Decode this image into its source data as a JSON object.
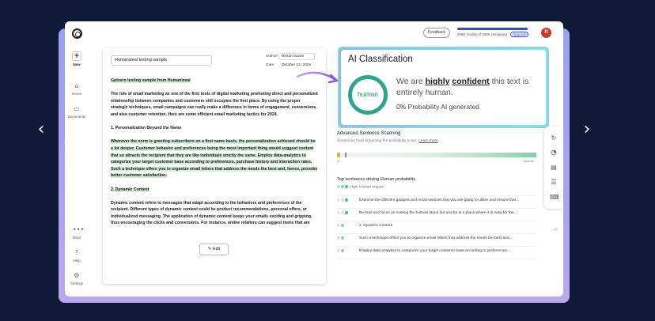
{
  "nav": {
    "prev": "‹",
    "next": "›"
  },
  "topbar": {
    "feedback_label": "Feedback",
    "credits_text": "298K credits of 300K remaining",
    "credits_fraction": 0.99,
    "upgrade_label": "Upgrade",
    "avatar_initial": "R"
  },
  "sidebar": {
    "new_label": "New",
    "items": [
      {
        "label": "Home",
        "icon": "home-icon",
        "glyph": "⌂"
      },
      {
        "label": "Documents",
        "icon": "folder-icon",
        "glyph": "▭"
      },
      {
        "label": "More",
        "icon": "more-icon",
        "glyph": "•••"
      },
      {
        "label": "Help",
        "icon": "help-icon",
        "glyph": "?"
      },
      {
        "label": "Settings",
        "icon": "gear-icon",
        "glyph": "⚙"
      }
    ]
  },
  "document": {
    "title": "Humanizeai testing sample",
    "author_label": "Author:",
    "author": "Rezan buzan",
    "date_label": "Date:",
    "date": "October 12, 2024",
    "heading": "Gptzero testing sample from Humanizeai",
    "p1": "The role of email marketing as one of the first tools of digital marketing promoting direct and personalized relationship between companies and customers still occupies the first place. By using the proper strategic techniques, email campaigns can really make a difference in terms of engagement, conversions, and also customer retention. Here are some efficient email marketing tactics for 2024.",
    "h1": "1. Personalization Beyond the Name",
    "p2": "Wherever the norm is greeting subscribers on a first name basis, the personalization achieved should be a lot deeper. Customer behavior and preferences being the most important thing would suggest content that so attracts the recipient that they are like individuals strictly the same. Employ data-analytics to categorize your target customer base according to preferences, purchase history and interaction rates. Such a technique offers you to organize email letters that address the needs the best and, hence, provoke better customer satisfaction.",
    "h2": "2. Dynamic Content",
    "p3": "Dynamic content refers to messages that adapt according to the behaviors and preferences of the recipient. Different types of dynamic content could be product recommendations, personal offers, or individualized messaging. The application of dynamic content keeps your emails exciting and gripping, thus encouraging the clicks and conversions. For instance, online retailers can suggest items that are",
    "edit_label": "Edit"
  },
  "classification": {
    "title": "AI Classification",
    "verdict_label": "human",
    "verdict_prefix": "We are",
    "verdict_em1": "highly",
    "verdict_em2": "confident",
    "verdict_suffix": "this text is entirely human.",
    "probability": "0% Probability AI generated",
    "ring_color": "#2fa58b"
  },
  "scanning": {
    "title": "Advanced Sentence Scanning",
    "subtitle": "Sentences most impacting the probability score.",
    "learn_more": "Learn more",
    "ai_label": "AI",
    "human_label": "Human",
    "human_color": "#7ed3a4"
  },
  "top_sentences": {
    "title": "Top sentences driving Human probability",
    "legend": "High Human Impact",
    "rows": [
      "Examine the different gadgets and email services that you are going to utilize and ensure that...",
      "Be brief and focus on making the buttons stand out and be in a place where it is easy for the...",
      "2. Dynamic Content",
      "Such a technique offers you to organize email letters that address the needs the best and,...",
      "Employ data-analytics to categorize your target customer base according to preferences,..."
    ]
  },
  "tools": [
    {
      "icon": "refresh-icon",
      "glyph": "↻"
    },
    {
      "icon": "gauge-icon",
      "glyph": "◔"
    },
    {
      "icon": "document-icon",
      "glyph": "▤"
    },
    {
      "icon": "edit-list-icon",
      "glyph": "☰"
    },
    {
      "icon": "keyboard-icon",
      "glyph": "⌨"
    }
  ]
}
